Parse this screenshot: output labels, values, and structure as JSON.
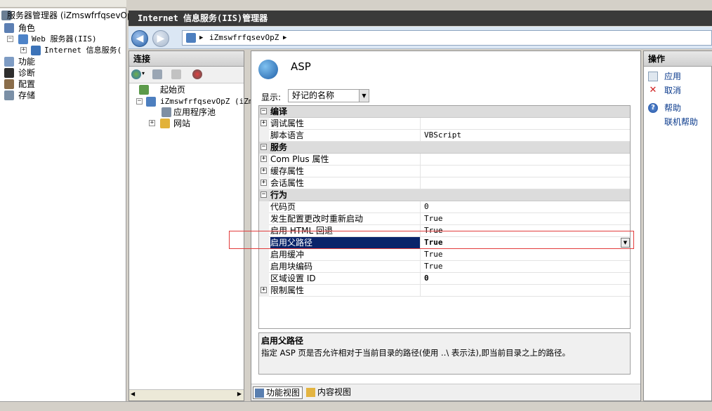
{
  "left_tree": {
    "root": "服务器管理器 (iZmswfrfqsevOp",
    "roles": "角色",
    "web_server": "Web 服务器(IIS)",
    "iis_manager": "Internet 信息服务(",
    "features": "功能",
    "diagnostics": "诊断",
    "configuration": "配置",
    "storage": "存储"
  },
  "window": {
    "title": "Internet 信息服务(IIS)管理器"
  },
  "nav": {
    "address": "iZmswfrfqsevOpZ",
    "back_icon": "arrow-left",
    "forward_icon": "arrow-right"
  },
  "connections": {
    "header": "连接",
    "items": [
      {
        "label": "起始页"
      },
      {
        "label": "iZmswfrfqsevOpZ (iZm"
      },
      {
        "label": "应用程序池"
      },
      {
        "label": "网站"
      }
    ]
  },
  "feature": {
    "title": "ASP",
    "display_label": "显示:",
    "display_value": "好记的名称",
    "grid": [
      {
        "type": "category",
        "name": "编译",
        "expander": "⊟"
      },
      {
        "type": "prop",
        "name": "调试属性",
        "value": "",
        "expander": "⊞"
      },
      {
        "type": "prop",
        "name": "脚本语言",
        "value": "VBScript",
        "expander": ""
      },
      {
        "type": "category",
        "name": "服务",
        "expander": "⊟"
      },
      {
        "type": "prop",
        "name": "Com Plus 属性",
        "value": "",
        "expander": "⊞"
      },
      {
        "type": "prop",
        "name": "缓存属性",
        "value": "",
        "expander": "⊞"
      },
      {
        "type": "prop",
        "name": "会话属性",
        "value": "",
        "expander": "⊞"
      },
      {
        "type": "category",
        "name": "行为",
        "expander": "⊟"
      },
      {
        "type": "prop",
        "name": "代码页",
        "value": "0",
        "expander": ""
      },
      {
        "type": "prop",
        "name": "发生配置更改时重新启动",
        "value": "True",
        "expander": ""
      },
      {
        "type": "prop",
        "name": "启用 HTML 回退",
        "value": "True",
        "expander": ""
      },
      {
        "type": "prop",
        "name": "启用父路径",
        "value": "True",
        "expander": "",
        "selected": true
      },
      {
        "type": "prop",
        "name": "启用缓冲",
        "value": "True",
        "expander": ""
      },
      {
        "type": "prop",
        "name": "启用块编码",
        "value": "True",
        "expander": ""
      },
      {
        "type": "prop",
        "name": "区域设置 ID",
        "value": "0",
        "expander": "",
        "bold_value": true
      },
      {
        "type": "prop",
        "name": "限制属性",
        "value": "",
        "expander": "⊞"
      }
    ],
    "description_title": "启用父路径",
    "description_text": "指定 ASP 页是否允许相对于当前目录的路径(使用 ..\\ 表示法),即当前目录之上的路径。"
  },
  "view_tabs": {
    "features_view": "功能视图",
    "content_view": "内容视图"
  },
  "actions": {
    "header": "操作",
    "apply": "应用",
    "cancel": "取消",
    "help": "帮助",
    "online_help": "联机帮助"
  },
  "colors": {
    "selection": "#0a246a",
    "highlight_border": "#e23c3c",
    "title_bar": "#3a3a3a",
    "link": "#0a3a8c"
  }
}
